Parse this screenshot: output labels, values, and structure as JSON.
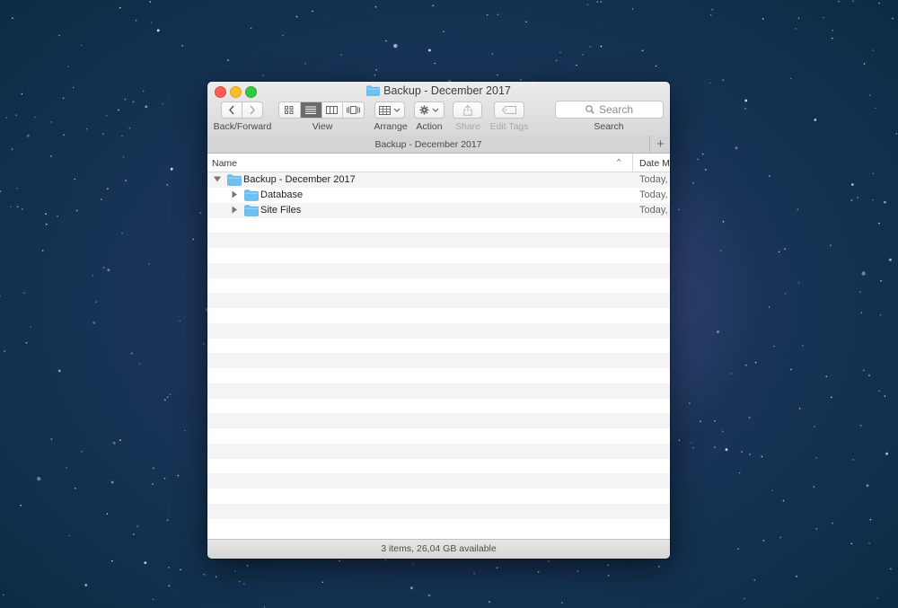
{
  "window": {
    "title": "Backup - December 2017"
  },
  "toolbar": {
    "back_forward_label": "Back/Forward",
    "view_label": "View",
    "arrange_label": "Arrange",
    "action_label": "Action",
    "share_label": "Share",
    "edit_tags_label": "Edit Tags",
    "search_label": "Search",
    "search_placeholder": "Search",
    "view_modes": [
      "icon",
      "list",
      "column",
      "cover-flow"
    ],
    "active_view": "list"
  },
  "pathbar": {
    "title": "Backup - December 2017",
    "add_tab": "+"
  },
  "columns": {
    "name": "Name",
    "date": "Date Mo"
  },
  "files": [
    {
      "name": "Backup - December 2017",
      "date": "Today,",
      "expanded": true,
      "level": 0
    },
    {
      "name": "Database",
      "date": "Today,",
      "expanded": false,
      "level": 1
    },
    {
      "name": "Site Files",
      "date": "Today,",
      "expanded": false,
      "level": 1
    }
  ],
  "status": {
    "text": "3 items, 26,04 GB available"
  },
  "colors": {
    "folder": "#6cc1f2",
    "close": "#fc5f57",
    "minimize": "#fdbc2e",
    "maximize": "#33c748"
  }
}
